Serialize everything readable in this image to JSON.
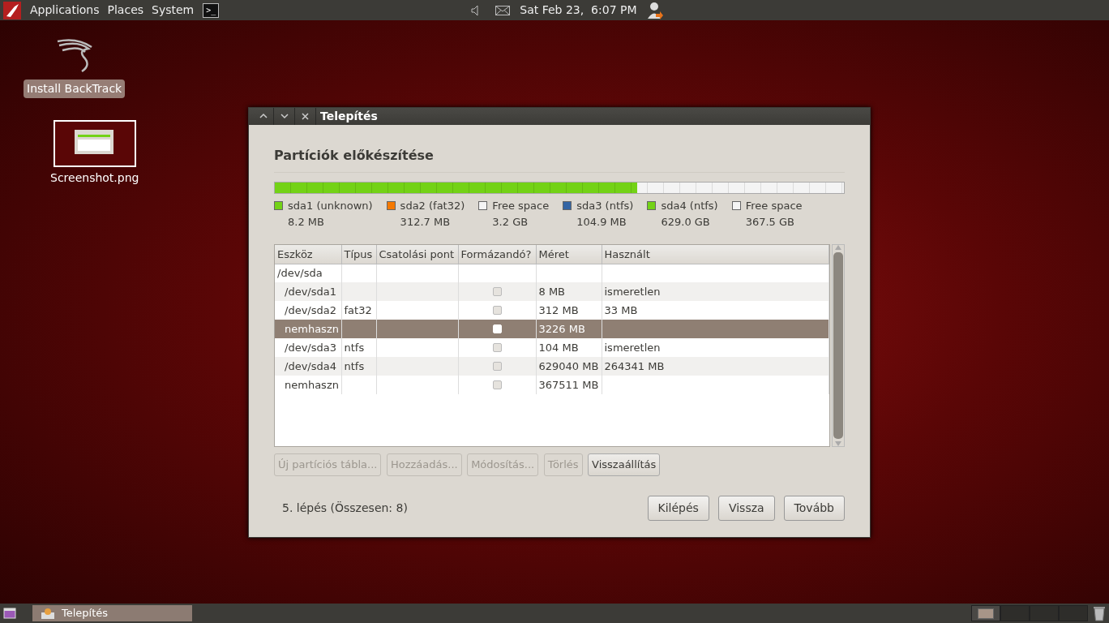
{
  "top_panel": {
    "menus": [
      {
        "label": "Applications"
      },
      {
        "label": "Places"
      },
      {
        "label": "System"
      }
    ],
    "terminal_label": ">_",
    "clock": "Sat Feb 23,  6:07 PM"
  },
  "desktop_icons": [
    {
      "kind": "app",
      "label": "Install BackTrack",
      "selected": true
    },
    {
      "kind": "image",
      "label": "Screenshot.png",
      "selected": false
    }
  ],
  "window": {
    "title": "Telepítés",
    "heading": "Partíciók előkészítése",
    "partition_bar": {
      "level": 0.637
    },
    "partitions": [
      {
        "name": "sda1 (unknown)",
        "size": "8.2 MB",
        "color": "#73d216"
      },
      {
        "name": "sda2 (fat32)",
        "size": "312.7 MB",
        "color": "#f57900"
      },
      {
        "name": "Free space",
        "size": "3.2 GB",
        "color": "#f4f4f4"
      },
      {
        "name": "sda3 (ntfs)",
        "size": "104.9 MB",
        "color": "#3465a4"
      },
      {
        "name": "sda4 (ntfs)",
        "size": "629.0 GB",
        "color": "#73d216"
      },
      {
        "name": "Free space",
        "size": "367.5 GB",
        "color": "#f4f4f4"
      }
    ],
    "table": {
      "columns": [
        "Eszköz",
        "Típus",
        "Csatolási pont",
        "Formázandó?",
        "Méret",
        "Használt"
      ],
      "rows": [
        {
          "device": "/dev/sda",
          "selected": false,
          "children": [
            {
              "device": "/dev/sda1",
              "format": false,
              "size": "8 MB",
              "used": "ismeretlen",
              "selected": false
            },
            {
              "device": "/dev/sda2",
              "type": "fat32",
              "format": false,
              "size": "312 MB",
              "used": "33 MB",
              "selected": false
            },
            {
              "device": "nemhaszn",
              "format": false,
              "size": "3226 MB",
              "selected": true
            },
            {
              "device": "/dev/sda3",
              "type": "ntfs",
              "format": false,
              "size": "104 MB",
              "used": "ismeretlen",
              "selected": false
            },
            {
              "device": "/dev/sda4",
              "type": "ntfs",
              "format": false,
              "size": "629040 MB",
              "used": "264341 MB",
              "selected": false
            },
            {
              "device": "nemhaszn",
              "format": false,
              "size": "367511 MB",
              "selected": false
            }
          ]
        }
      ]
    },
    "actions": [
      {
        "label": "Új partíciós tábla...",
        "disabled": true
      },
      {
        "label": "Hozzáadás...",
        "disabled": true
      },
      {
        "label": "Módosítás...",
        "disabled": true
      },
      {
        "label": "Törlés",
        "disabled": true
      },
      {
        "label": "Visszaállítás",
        "disabled": false
      }
    ],
    "step": "5. lépés (Összesen: 8)",
    "nav_buttons": [
      {
        "label": "Kilépés"
      },
      {
        "label": "Vissza"
      },
      {
        "label": "Tovább"
      }
    ]
  },
  "taskbar": {
    "tasks": [
      {
        "label": "Telepítés",
        "selected": true
      }
    ],
    "workspaces": [
      {
        "selected": true
      },
      {
        "selected": false
      },
      {
        "selected": false
      },
      {
        "selected": false
      }
    ]
  }
}
